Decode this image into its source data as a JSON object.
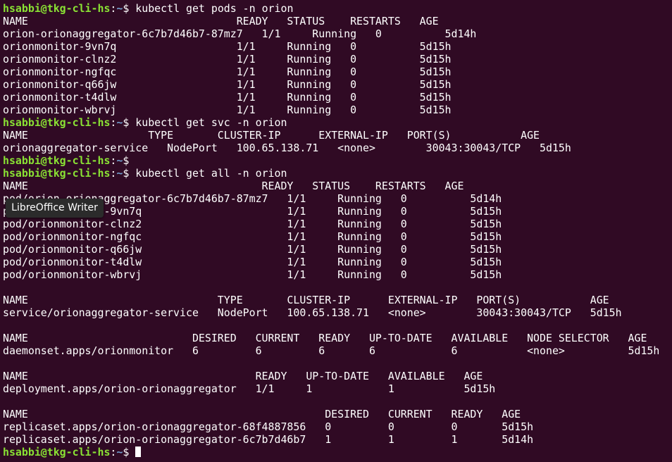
{
  "prompt": {
    "user": "hsabbi@tkg-cli-hs",
    "sep": ":",
    "path": "~",
    "symbol": "$ "
  },
  "lines": [
    {
      "type": "prompt",
      "text": "kubectl get pods -n orion"
    },
    {
      "type": "output",
      "text": "NAME                                 READY   STATUS    RESTARTS   AGE"
    },
    {
      "type": "output",
      "text": "orion-orionaggregator-6c7b7d46b7-87mz7   1/1     Running   0          5d14h"
    },
    {
      "type": "output",
      "text": "orionmonitor-9vn7q                   1/1     Running   0          5d15h"
    },
    {
      "type": "output",
      "text": "orionmonitor-clnz2                   1/1     Running   0          5d15h"
    },
    {
      "type": "output",
      "text": "orionmonitor-ngfqc                   1/1     Running   0          5d15h"
    },
    {
      "type": "output",
      "text": "orionmonitor-q66jw                   1/1     Running   0          5d15h"
    },
    {
      "type": "output",
      "text": "orionmonitor-t4dlw                   1/1     Running   0          5d15h"
    },
    {
      "type": "output",
      "text": "orionmonitor-wbrvj                   1/1     Running   0          5d15h"
    },
    {
      "type": "prompt",
      "text": "kubectl get svc -n orion"
    },
    {
      "type": "output",
      "text": "NAME                   TYPE       CLUSTER-IP      EXTERNAL-IP   PORT(S)           AGE"
    },
    {
      "type": "output",
      "text": "orionaggregator-service   NodePort   100.65.138.71   <none>        30043:30043/TCP   5d15h"
    },
    {
      "type": "prompt",
      "text": ""
    },
    {
      "type": "prompt",
      "text": "kubectl get all -n orion"
    },
    {
      "type": "output",
      "text": "NAME                                     READY   STATUS    RESTARTS   AGE"
    },
    {
      "type": "output",
      "text": "pod/orion-orionaggregator-6c7b7d46b7-87mz7   1/1     Running   0          5d14h"
    },
    {
      "type": "output",
      "text": "pod/orionmonitor-9vn7q                       1/1     Running   0          5d15h"
    },
    {
      "type": "output",
      "text": "pod/orionmonitor-clnz2                       1/1     Running   0          5d15h"
    },
    {
      "type": "output",
      "text": "pod/orionmonitor-ngfqc                       1/1     Running   0          5d15h"
    },
    {
      "type": "output",
      "text": "pod/orionmonitor-q66jw                       1/1     Running   0          5d15h"
    },
    {
      "type": "output",
      "text": "pod/orionmonitor-t4dlw                       1/1     Running   0          5d15h"
    },
    {
      "type": "output",
      "text": "pod/orionmonitor-wbrvj                       1/1     Running   0          5d15h"
    },
    {
      "type": "output",
      "text": ""
    },
    {
      "type": "output",
      "text": "NAME                              TYPE       CLUSTER-IP      EXTERNAL-IP   PORT(S)           AGE"
    },
    {
      "type": "output",
      "text": "service/orionaggregator-service   NodePort   100.65.138.71   <none>        30043:30043/TCP   5d15h"
    },
    {
      "type": "output",
      "text": ""
    },
    {
      "type": "output",
      "text": "NAME                          DESIRED   CURRENT   READY   UP-TO-DATE   AVAILABLE   NODE SELECTOR   AGE"
    },
    {
      "type": "output",
      "text": "daemonset.apps/orionmonitor   6         6         6       6            6           <none>          5d15h"
    },
    {
      "type": "output",
      "text": ""
    },
    {
      "type": "output",
      "text": "NAME                                    READY   UP-TO-DATE   AVAILABLE   AGE"
    },
    {
      "type": "output",
      "text": "deployment.apps/orion-orionaggregator   1/1     1            1           5d15h"
    },
    {
      "type": "output",
      "text": ""
    },
    {
      "type": "output",
      "text": "NAME                                               DESIRED   CURRENT   READY   AGE"
    },
    {
      "type": "output",
      "text": "replicaset.apps/orion-orionaggregator-68f4887856   0         0         0       5d15h"
    },
    {
      "type": "output",
      "text": "replicaset.apps/orion-orionaggregator-6c7b7d46b7   1         1         1       5d14h"
    },
    {
      "type": "prompt",
      "text": ""
    }
  ],
  "tooltip": "LibreOffice Writer",
  "colors": {
    "background": "#300a24",
    "text": "#ffffff",
    "user": "#8ae234",
    "path": "#729fcf"
  }
}
